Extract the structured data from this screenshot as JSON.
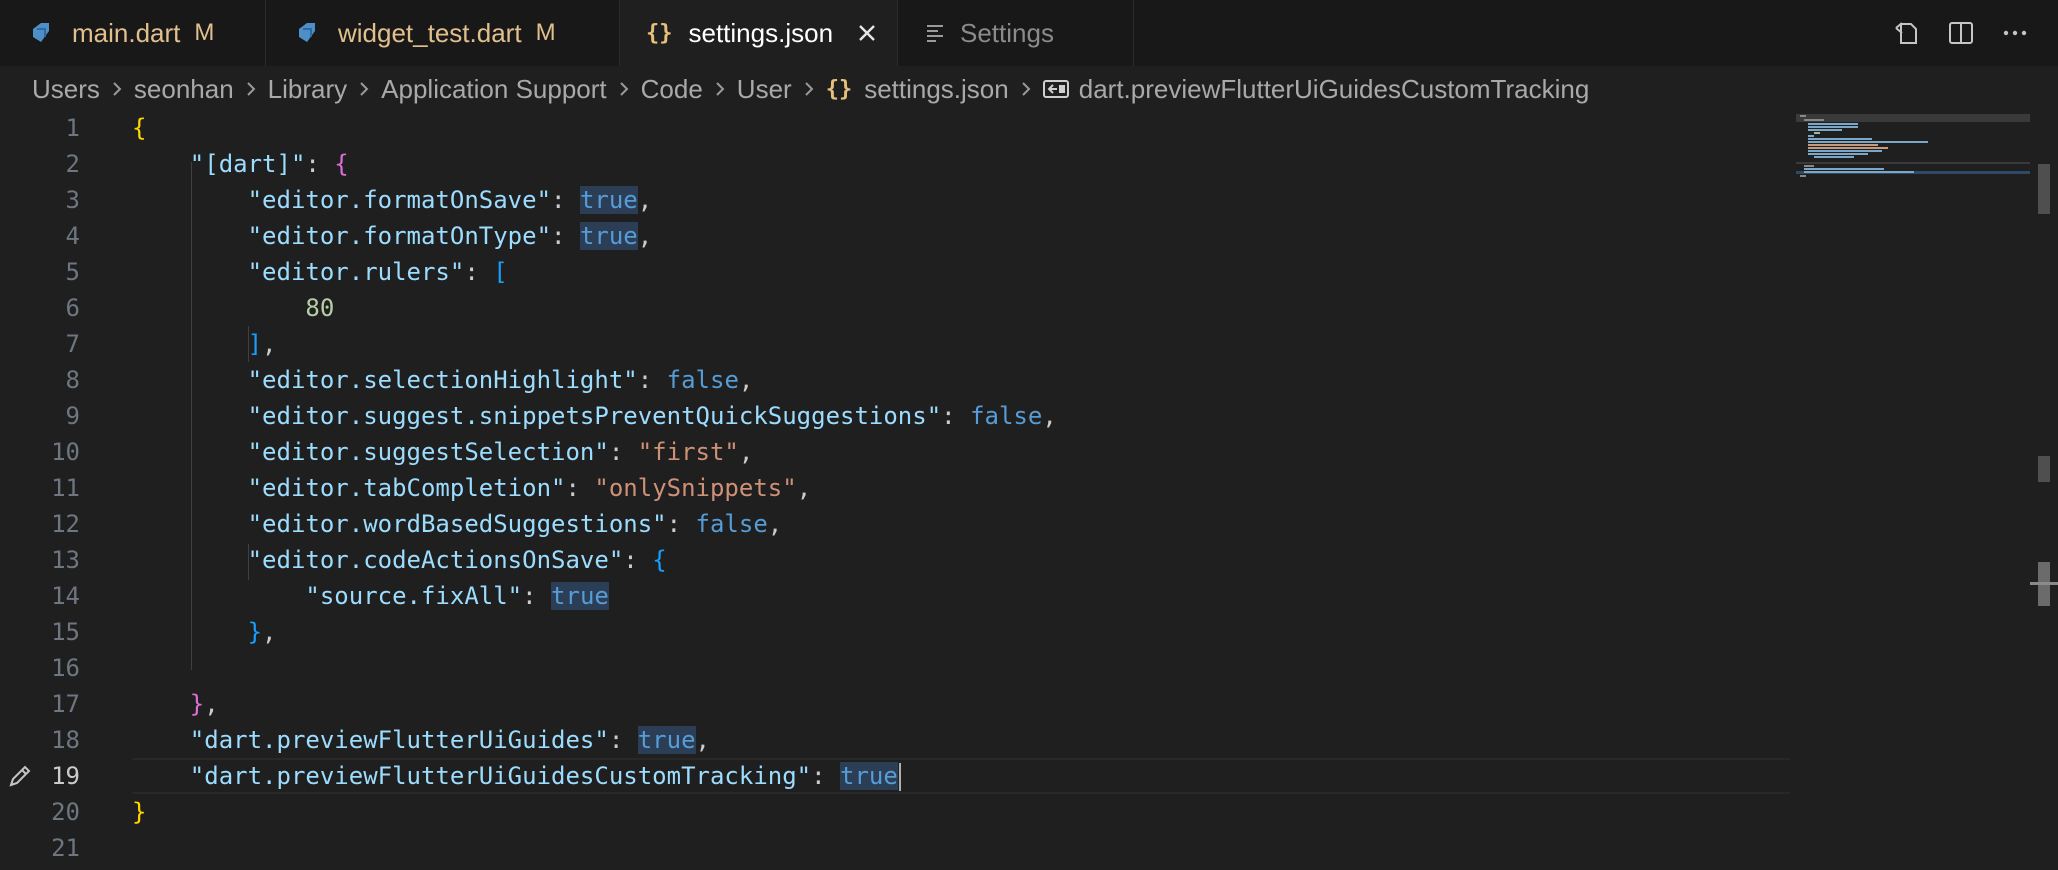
{
  "tabs": [
    {
      "label": "main.dart",
      "status": "M"
    },
    {
      "label": "widget_test.dart",
      "status": "M"
    },
    {
      "label": "settings.json"
    },
    {
      "label": "Settings"
    }
  ],
  "breadcrumb": [
    "Users",
    "seonhan",
    "Library",
    "Application Support",
    "Code",
    "User",
    "settings.json",
    "dart.previewFlutterUiGuidesCustomTracking"
  ],
  "line_numbers": [
    "1",
    "2",
    "3",
    "4",
    "5",
    "6",
    "7",
    "8",
    "9",
    "10",
    "11",
    "12",
    "13",
    "14",
    "15",
    "16",
    "17",
    "18",
    "19",
    "20",
    "21"
  ],
  "code": {
    "l1_brace": "{",
    "l2_key": "\"[dart]\"",
    "l2_brace": "{",
    "l3_key": "\"editor.formatOnSave\"",
    "l3_val": "true",
    "l4_key": "\"editor.formatOnType\"",
    "l4_val": "true",
    "l5_key": "\"editor.rulers\"",
    "l5_bracket": "[",
    "l6_num": "80",
    "l7_bracket": "]",
    "l8_key": "\"editor.selectionHighlight\"",
    "l8_val": "false",
    "l9_key": "\"editor.suggest.snippetsPreventQuickSuggestions\"",
    "l9_val": "false",
    "l10_key": "\"editor.suggestSelection\"",
    "l10_val": "\"first\"",
    "l11_key": "\"editor.tabCompletion\"",
    "l11_val": "\"onlySnippets\"",
    "l12_key": "\"editor.wordBasedSuggestions\"",
    "l12_val": "false",
    "l13_key": "\"editor.codeActionsOnSave\"",
    "l13_brace": "{",
    "l14_key": "\"source.fixAll\"",
    "l14_val": "true",
    "l15_brace": "}",
    "l17_brace": "}",
    "l18_key": "\"dart.previewFlutterUiGuides\"",
    "l18_val": "true",
    "l19_key": "\"dart.previewFlutterUiGuidesCustomTracking\"",
    "l19_val": "true",
    "l20_brace": "}"
  },
  "colors": {
    "background": "#1f1f1f",
    "key": "#9cdcfe",
    "string": "#ce9178",
    "boolean": "#569cd6",
    "number": "#b5cea8",
    "modified": "#e2c08d"
  },
  "icons": {
    "tab_dart": "dart-icon",
    "tab_json": "braces-icon",
    "tab_settings": "settings-lines-icon",
    "tab_close": "close-icon",
    "actions": [
      "open-changes-icon",
      "split-editor-icon",
      "more-actions-icon"
    ],
    "gutter": "pencil-icon"
  }
}
